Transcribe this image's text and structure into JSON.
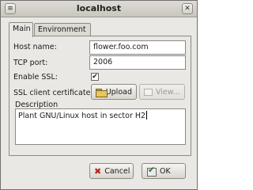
{
  "window": {
    "title": "localhost",
    "menu_icon": "window-menu-icon",
    "close_icon": "close-icon"
  },
  "tabs": [
    {
      "label": "Main",
      "active": true
    },
    {
      "label": "Environment",
      "active": false
    }
  ],
  "form": {
    "host_label": "Host name:",
    "host_value": "flower.foo.com",
    "port_label": "TCP port:",
    "port_value": "2006",
    "ssl_label": "Enable SSL:",
    "ssl_checked": true,
    "ssl_check_mark": "✔",
    "cert_label": "SSL client certificate:",
    "upload_label": "Upload",
    "upload_icon": "folder-icon",
    "view_label": "View...",
    "description_label": "Description",
    "description_value": "Plant GNU/Linux host in sector H2"
  },
  "actions": {
    "cancel_label": "Cancel",
    "cancel_icon": "cancel-x-icon",
    "ok_label": "OK",
    "ok_icon": "ok-check-icon"
  }
}
